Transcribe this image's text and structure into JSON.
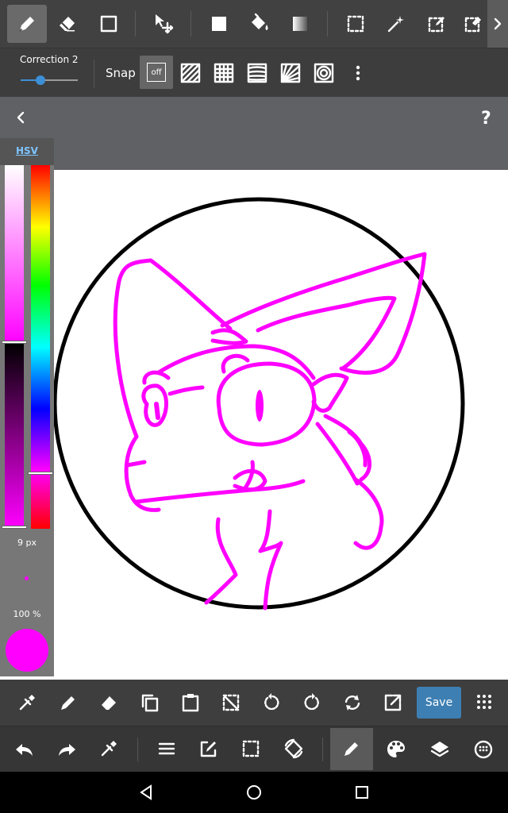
{
  "toolbar": {
    "tools": [
      "pen-icon",
      "eraser-icon",
      "rectangle-icon",
      "move-icon",
      "fill-color-icon",
      "bucket-icon",
      "gradient-icon",
      "selection-icon",
      "magic-wand-icon",
      "select-pen-icon",
      "select-eraser-icon",
      "more-arrow-icon"
    ]
  },
  "options": {
    "brush_name": "Correction 2",
    "snap_label": "Snap",
    "snap_off": "off",
    "slider_value": 0.35
  },
  "color_panel": {
    "mode_label": "HSV",
    "brush_size": "9 px",
    "opacity": "100 %",
    "current_color": "#ff00ff"
  },
  "bottom_toolbar": {
    "save_label": "Save"
  },
  "colors": {
    "stroke": "#ff00ff",
    "accent": "#3d7fb3"
  }
}
